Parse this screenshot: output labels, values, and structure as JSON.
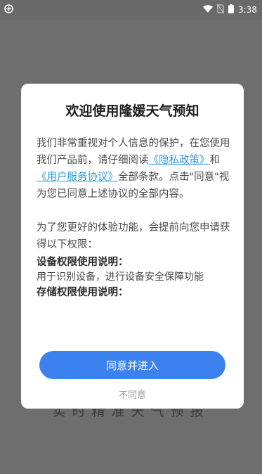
{
  "status_bar": {
    "time": "3:38"
  },
  "background": {
    "caption": "实时精准天气预报"
  },
  "dialog": {
    "title": "欢迎使用隆媛天气预知",
    "intro_p1": "我们非常重视对个人信息的保护，在您使用我们产品前，请仔细阅读",
    "privacy_link": "《隐私政策》",
    "and_text": "和",
    "service_link": "《用户服务协议》",
    "intro_p2": "全部条款。点击\"同意\"视为您已同意上述协议的全部内容。",
    "permission_intro": "为了您更好的体验功能，会提前向您申请获得以下权限：",
    "permissions": [
      {
        "title": "设备权限使用说明：",
        "desc": "用于识别设备，进行设备安全保障功能"
      },
      {
        "title": "存储权限使用说明：",
        "desc": ""
      }
    ],
    "agree_label": "同意并进入",
    "disagree_label": "不同意"
  },
  "colors": {
    "accent": "#3b82f0",
    "link": "#2f9bd6",
    "overlay": "#6e6e6e"
  }
}
